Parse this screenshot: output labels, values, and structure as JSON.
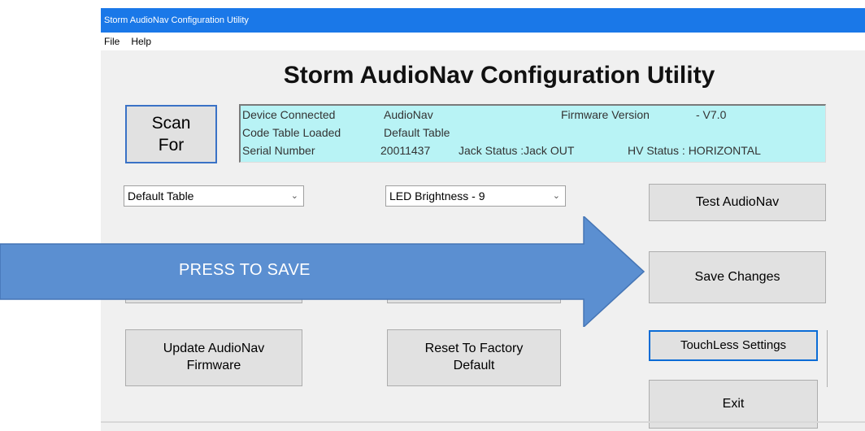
{
  "window": {
    "title": "Storm AudioNav Configuration Utility"
  },
  "menu": {
    "file": "File",
    "help": "Help"
  },
  "app_title": "Storm AudioNav Configuration Utility",
  "scan_button": {
    "line1": "Scan",
    "line2": "For"
  },
  "device_info": {
    "device_connected_label": "Device Connected",
    "device_connected_value": "AudioNav",
    "firmware_label": "Firmware Version",
    "firmware_value": "-  V7.0",
    "code_table_label": "Code Table Loaded",
    "code_table_value": "Default Table",
    "serial_label": "Serial Number",
    "serial_value": "20011437",
    "jack_status": "Jack Status :Jack OUT",
    "hv_status": "HV Status : HORIZONTAL"
  },
  "code_table_select": {
    "value": "Default Table"
  },
  "led_select": {
    "value": "LED Brightness - 9"
  },
  "buttons": {
    "test_audionav": "Test AudioNav",
    "save_changes": "Save Changes",
    "update_firmware_line1": "Update AudioNav",
    "update_firmware_line2": "Firmware",
    "reset_factory_line1": "Reset To Factory",
    "reset_factory_line2": "Default",
    "touchless_settings": "TouchLess Settings",
    "exit": "Exit"
  },
  "annotation": {
    "text": "PRESS TO SAVE",
    "color": "#5b8fd1"
  },
  "colors": {
    "titlebar": "#1a78e8",
    "info_panel": "#b8f3f5"
  }
}
